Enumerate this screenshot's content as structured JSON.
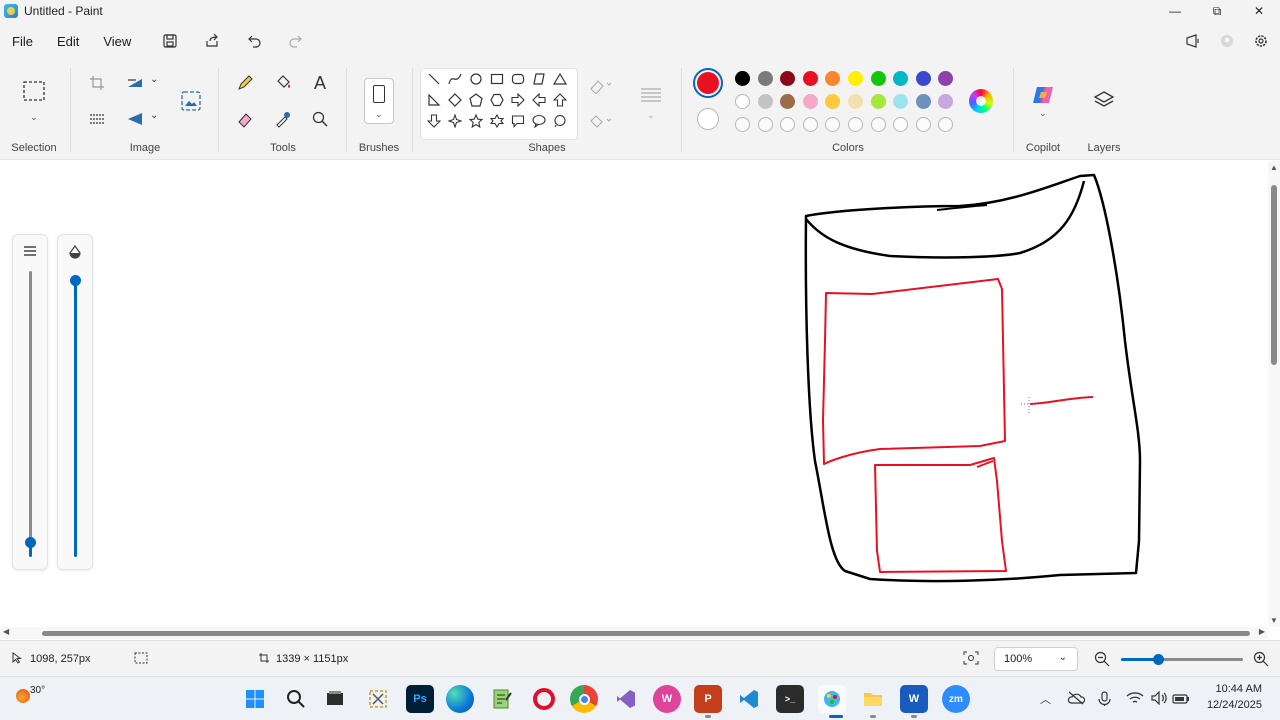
{
  "window": {
    "title": "Untitled - Paint",
    "minimize_label": "—",
    "maximize_label": "⧉",
    "close_label": "✕"
  },
  "menu": {
    "file": "File",
    "edit": "Edit",
    "view": "View"
  },
  "ribbon": {
    "groups": {
      "selection": "Selection",
      "image": "Image",
      "tools": "Tools",
      "brushes": "Brushes",
      "shapes": "Shapes",
      "colors": "Colors",
      "copilot": "Copilot",
      "layers": "Layers"
    },
    "text_tool_glyph": "A",
    "colors": {
      "primary": "#e81123",
      "secondary": "#ffffff",
      "palette_row1": [
        "#000000",
        "#7a7a7a",
        "#8b0a1a",
        "#e81123",
        "#f7882f",
        "#fff100",
        "#16c60c",
        "#00b7c3",
        "#3a48cf",
        "#8e40ab"
      ],
      "palette_row2": [
        "#ffffff",
        "#c3c3c3",
        "#9c6b4a",
        "#f7a8c8",
        "#ffc83d",
        "#f0e2b0",
        "#a4e83c",
        "#9de3ee",
        "#6f8fbd",
        "#c8a8df"
      ]
    }
  },
  "canvas": {
    "stroke_primary": "#e81123",
    "stroke_outline": "#000000"
  },
  "status": {
    "cursor_position": "1098, 257px",
    "canvas_size": "1339 × 1151px",
    "zoom_value": "100%",
    "zoom_level": 0.3
  },
  "taskbar": {
    "weather_temp": "30°",
    "time": "10:44 AM",
    "date": "12/24/2025"
  }
}
